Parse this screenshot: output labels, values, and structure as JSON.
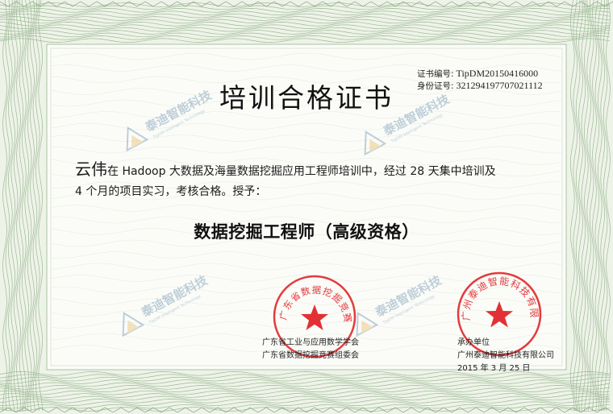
{
  "certificate": {
    "cert_no_label": "证书编号:",
    "cert_no": "TipDM20150416000",
    "id_no_label": "身份证号:",
    "id_no": "321294197707021112",
    "title": "培训合格证书",
    "recipient": "云伟",
    "body_line1": "在 Hadoop 大数据及海量数据挖掘应用工程师培训中，经过 28 天集中培训及",
    "body_line2": "4 个月的项目实习，考核合格。授予：",
    "award": "数据挖掘工程师（高级资格）"
  },
  "issuers": {
    "left_org1": "广东省工业与应用数学学会",
    "left_org2": "广东省数据挖掘竞赛组委会",
    "right_label": "承办单位",
    "right_org": "广州泰迪智能科技有限公司",
    "date": "2015 年 3 月 25 日"
  },
  "seals": {
    "left_text": "广东省数据挖掘竞赛组委会",
    "right_text": "广州泰迪智能科技有限公司",
    "color": "#e0262a"
  },
  "watermark": {
    "text": "泰迪智能科技",
    "subtext": "TipDM Intelligent Technology",
    "color": "#3f6f9a"
  },
  "colors": {
    "border_green": "#8fb08a",
    "border_light": "#d6e3cf",
    "inner_bg": "#f7f9f3"
  }
}
